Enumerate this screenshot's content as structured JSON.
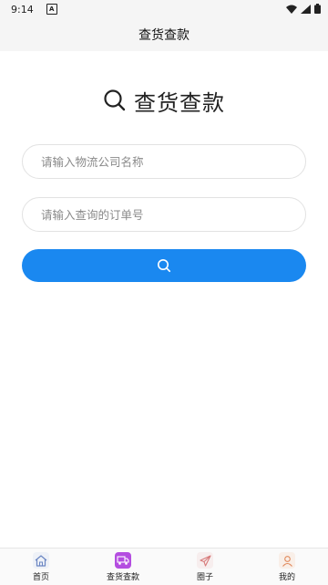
{
  "status": {
    "time": "9:14",
    "notification_letter": "A"
  },
  "header": {
    "title": "查货查款"
  },
  "hero": {
    "title": "查货查款"
  },
  "form": {
    "company_placeholder": "请输入物流公司名称",
    "company_value": "",
    "order_placeholder": "请输入查询的订单号",
    "order_value": ""
  },
  "colors": {
    "accent": "#1a88f0",
    "active_tab": "#b44de0",
    "tab_icon_bg": "#eef1f7"
  },
  "tabbar": {
    "items": [
      {
        "label": "首页",
        "icon": "home-icon",
        "active": false
      },
      {
        "label": "查货查款",
        "icon": "truck-icon",
        "active": true
      },
      {
        "label": "圈子",
        "icon": "paper-plane-icon",
        "active": false
      },
      {
        "label": "我的",
        "icon": "user-icon",
        "active": false
      }
    ]
  }
}
